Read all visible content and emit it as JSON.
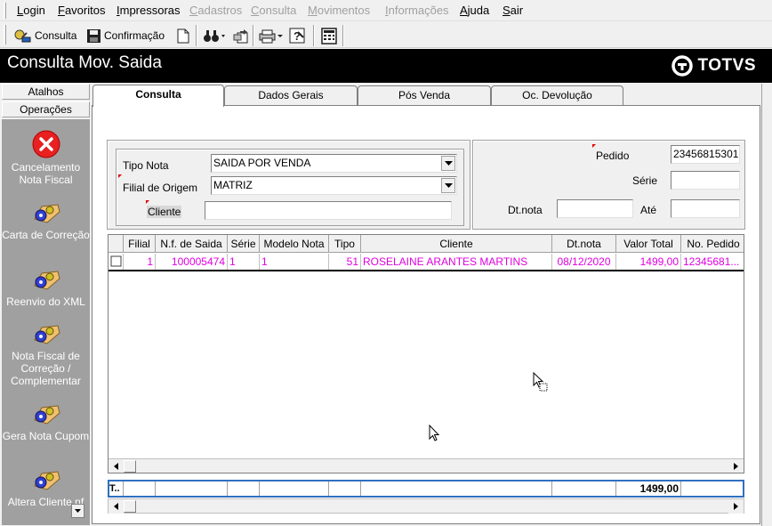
{
  "menu": {
    "items": [
      {
        "label": "Login",
        "underline": "L",
        "rest": "ogin",
        "enabled": true
      },
      {
        "label": "Favoritos",
        "underline": "F",
        "rest": "avoritos",
        "enabled": true
      },
      {
        "label": "Impressoras",
        "underline": "I",
        "rest": "mpressoras",
        "enabled": true
      },
      {
        "label": "Cadastros",
        "underline": "C",
        "rest": "adastros",
        "enabled": false
      },
      {
        "label": "Consulta",
        "underline": "C",
        "rest": "onsulta",
        "enabled": false
      },
      {
        "label": "Movimentos",
        "underline": "M",
        "rest": "ovimentos",
        "enabled": false
      },
      {
        "label": "Informações",
        "underline": "I",
        "rest": "nformações",
        "enabled": false
      },
      {
        "label": "Ajuda",
        "underline": "A",
        "rest": "juda",
        "enabled": true
      },
      {
        "label": "Sair",
        "underline": "S",
        "rest": "air",
        "enabled": true
      }
    ]
  },
  "toolbar": {
    "consulta_label": "Consulta",
    "confirmacao_label": "Confirmação"
  },
  "window": {
    "title": "Consulta Mov. Saida",
    "brand": "TOTVS"
  },
  "left_panel": {
    "atalhos_label": "Atalhos",
    "operacoes_label": "Operações",
    "items": [
      {
        "label": "Cancelamento Nota Fiscal",
        "icon": "red-x-icon"
      },
      {
        "label": "Carta de Correção",
        "icon": "operation-gear-icon"
      },
      {
        "label": "Reenvio do XML",
        "icon": "operation-gear-icon"
      },
      {
        "label": "Nota Fiscal de Correção / Complementar",
        "icon": "operation-gear-icon"
      },
      {
        "label": "Gera Nota Cupom",
        "icon": "operation-gear-icon"
      },
      {
        "label": "Altera Cliente nf",
        "icon": "operation-gear-icon"
      }
    ]
  },
  "tabs": [
    {
      "label": "Consulta",
      "active": true
    },
    {
      "label": "Dados Gerais",
      "active": false
    },
    {
      "label": "Pós Venda",
      "active": false
    },
    {
      "label": "Oc. Devolução",
      "active": false
    }
  ],
  "filters": {
    "tipo_nota_label": "Tipo Nota",
    "tipo_nota_value": "SAIDA POR VENDA",
    "filial_label": "Filial de Origem",
    "filial_value": "MATRIZ",
    "cliente_label": "Cliente",
    "cliente_value": "",
    "pedido_label": "Pedido",
    "pedido_value": "23456815301",
    "serie_label": "Série",
    "serie_value": "",
    "dtnota_label": "Dt.nota",
    "dtnota_value": "",
    "ate_label": "Até",
    "ate_value": ""
  },
  "grid": {
    "columns": [
      "Filial",
      "N.f. de Saida",
      "Série",
      "Modelo Nota",
      "Tipo",
      "Cliente",
      "Dt.nota",
      "Valor Total",
      "No. Pedido"
    ],
    "rows": [
      {
        "filial": "1",
        "nf": "100005474",
        "serie": "1",
        "modelo": "1",
        "tipo": "51",
        "cliente": "ROSELAINE ARANTES MARTINS",
        "dtnota": "08/12/2020",
        "valor": "1499,00",
        "pedido": "12345681..."
      }
    ],
    "totals_label": "T..",
    "total_value": "1499,00"
  },
  "colors": {
    "row_text": "#e000e0",
    "title_bg": "#000000",
    "required_marker": "#e00000",
    "totals_border": "#3070c0"
  }
}
